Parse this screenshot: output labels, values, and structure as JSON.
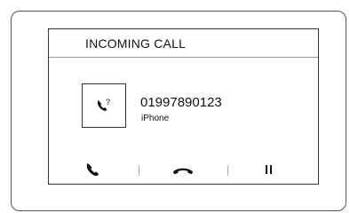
{
  "call": {
    "title": "INCOMING CALL",
    "number": "01997890123",
    "device": "iPhone",
    "avatar_icon": "unknown-caller-icon"
  },
  "actions": {
    "answer_icon": "phone-answer-icon",
    "decline_icon": "phone-hangup-icon",
    "hold_icon": "pause-icon"
  }
}
